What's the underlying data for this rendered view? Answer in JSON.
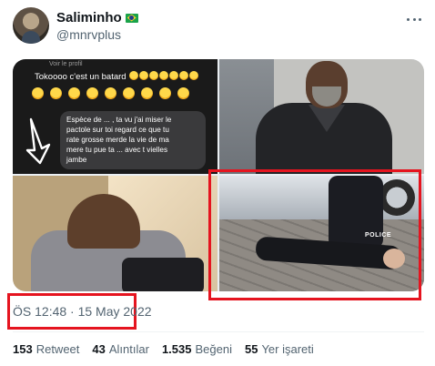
{
  "author": {
    "display_name": "Saliminho",
    "handle": "@mnrvplus",
    "badge_icon": "brazil-flag-icon"
  },
  "media": {
    "chat": {
      "top_caption": "Voir le profil",
      "line1": "Tokoooo c'est un batard",
      "bubble_lines": [
        "Espèce de ... , ta vu j'ai miser le",
        "pactole sur toi regard ce que tu",
        "rate grosse merde la vie de ma",
        "mere tu pue ta ... avec t vielles",
        "jambe"
      ]
    },
    "police_vest_text": "POLICE"
  },
  "timestamp": "ÖS 12:48 · 15 May 2022",
  "stats": [
    {
      "count": "153",
      "label": "Retweet"
    },
    {
      "count": "43",
      "label": "Alıntılar"
    },
    {
      "count": "1.535",
      "label": "Beğeni"
    },
    {
      "count": "55",
      "label": "Yer işareti"
    }
  ],
  "colors": {
    "highlight_red": "#e5141f",
    "secondary_text": "#536471",
    "primary_text": "#0f1419"
  }
}
